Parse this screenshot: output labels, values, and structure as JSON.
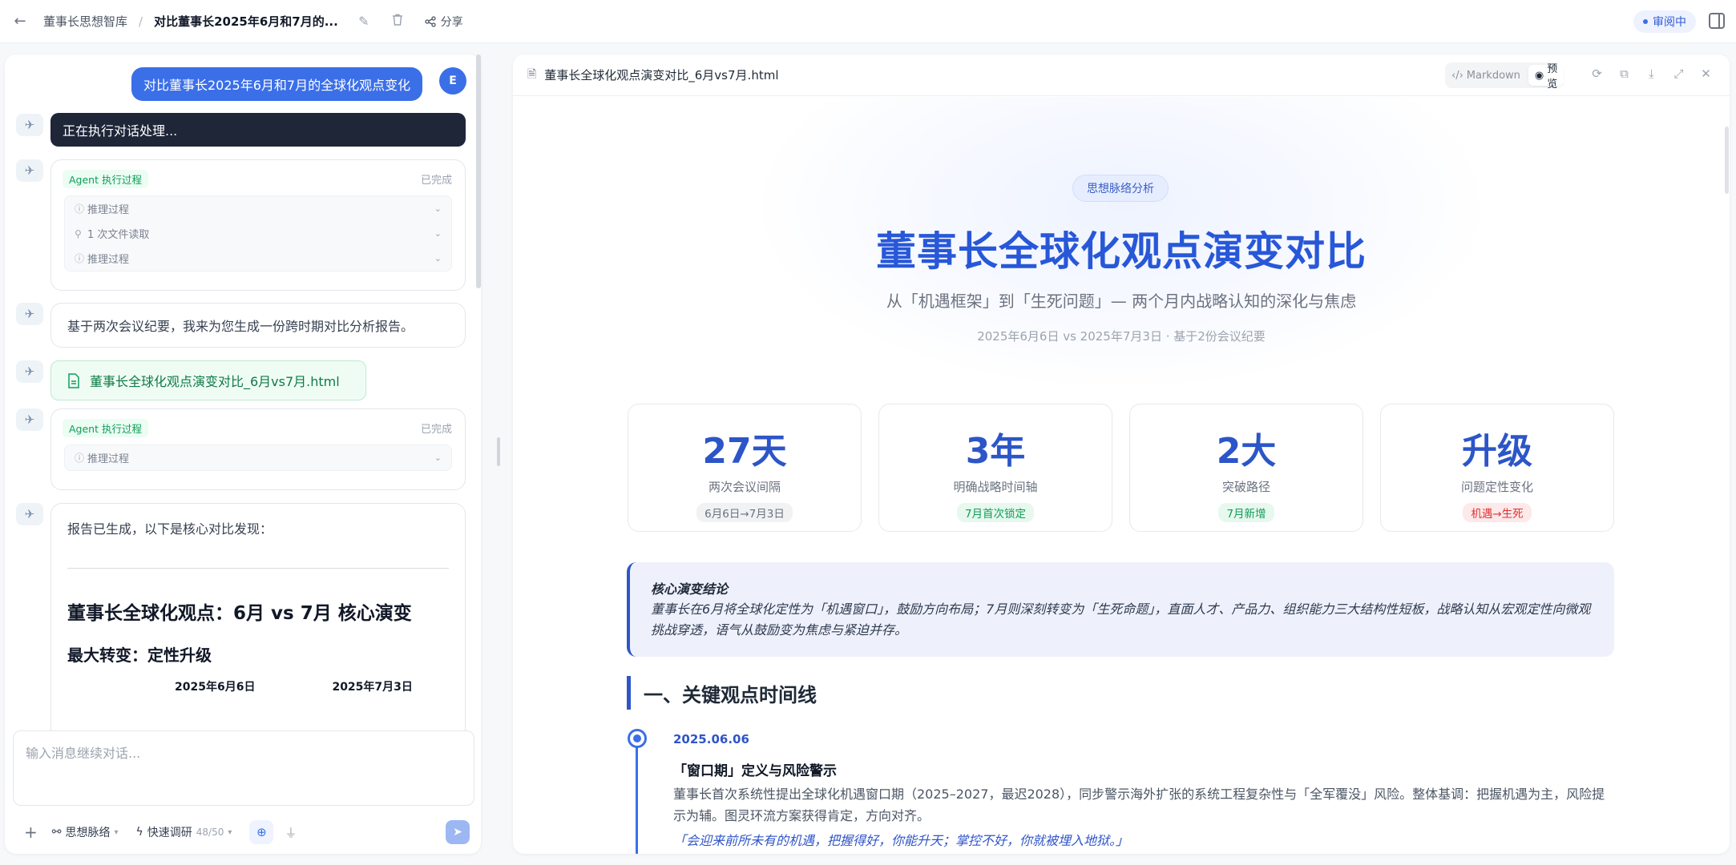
{
  "topbar": {
    "breadcrumb_root": "董事长思想智库",
    "breadcrumb_sep": "/",
    "title": "对比董事长2025年6月和7月的...",
    "share_label": "分享",
    "status": "审阅中"
  },
  "chat": {
    "user_message": "对比董事长2025年6月和7月的全球化观点变化",
    "user_avatar": "E",
    "executing": "正在执行对话处理...",
    "agent_card_1": {
      "badge": "Agent 执行过程",
      "status": "已完成",
      "steps": [
        "推理过程",
        "1 次文件读取",
        "推理过程"
      ]
    },
    "reply_1": "基于两次会议纪要，我来为您生成一份跨时期对比分析报告。",
    "file_name": "董事长全球化观点演变对比_6月vs7月.html",
    "agent_card_2": {
      "badge": "Agent 执行过程",
      "status": "已完成",
      "steps": [
        "推理过程"
      ]
    },
    "report": {
      "intro": "报告已生成，以下是核心对比发现：",
      "heading": "董事长全球化观点：6月 vs 7月 核心演变",
      "subheading": "最大转变：定性升级",
      "col_1": "2025年6月6日",
      "col_2": "2025年7月3日"
    },
    "composer_placeholder": "输入消息继续对话...",
    "tools": {
      "tool_1": "思想脉络",
      "tool_2": "快速调研",
      "tool_2_count": "48/50"
    }
  },
  "preview": {
    "file_title": "董事长全球化观点演变对比_6月vs7月.html",
    "mode_markdown": "Markdown",
    "mode_preview": "预览",
    "pill": "思想脉络分析",
    "title": "董事长全球化观点演变对比",
    "subtitle": "从「机遇框架」到「生死问题」— 两个月内战略认知的深化与焦虑",
    "meta": "2025年6月6日 vs 2025年7月3日 · 基于2份会议纪要",
    "stats": [
      {
        "value": "27天",
        "label": "两次会议间隔",
        "tag": "6月6日→7月3日"
      },
      {
        "value": "3年",
        "label": "明确战略时间轴",
        "tag": "7月首次锁定"
      },
      {
        "value": "2大",
        "label": "突破路径",
        "tag": "7月新增"
      },
      {
        "value": "升级",
        "label": "问题定性变化",
        "tag": "机遇→生死"
      }
    ],
    "conclusion_title": "核心演变结论",
    "conclusion_body": "董事长在6月将全球化定性为「机遇窗口」，鼓励方向布局；7月则深刻转变为「生死命题」，直面人才、产品力、组织能力三大结构性短板，战略认知从宏观定性向微观挑战穿透，语气从鼓励变为焦虑与紧迫并存。",
    "section_1": "一、关键观点时间线",
    "timeline": {
      "date": "2025.06.06",
      "heading": "「窗口期」定义与风险警示",
      "body": "董事长首次系统性提出全球化机遇窗口期（2025–2027，最迟2028），同步警示海外扩张的系统工程复杂性与「全军覆没」风险。整体基调：把握机遇为主，风险提示为辅。图灵环流方案获得肯定，方向对齐。",
      "quote": "「会迎来前所未有的机遇，把握得好，你能升天；掌控不好，你就被埋入地狱。」"
    }
  }
}
